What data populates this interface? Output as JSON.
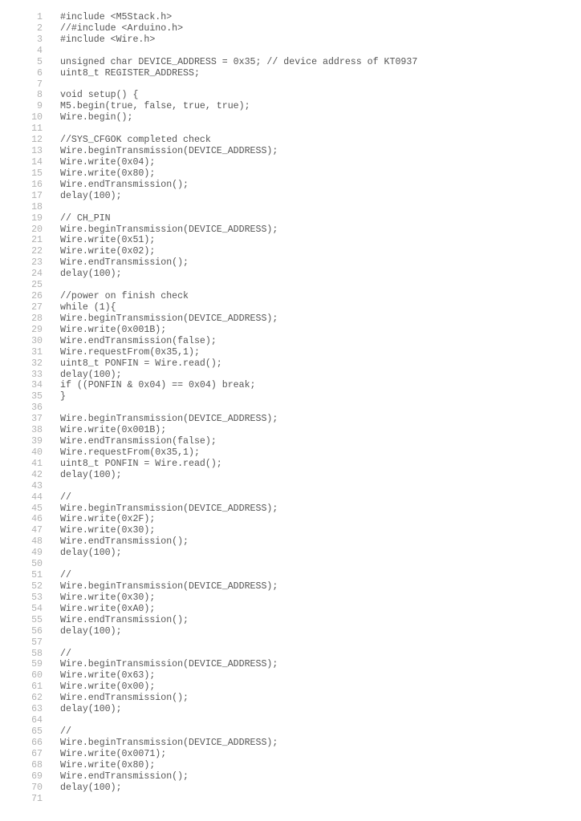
{
  "code": {
    "lines": [
      "#include <M5Stack.h>",
      "//#include <Arduino.h>",
      "#include <Wire.h>",
      "",
      "unsigned char DEVICE_ADDRESS = 0x35; // device address of KT0937",
      "uint8_t REGISTER_ADDRESS;",
      "",
      "void setup() {",
      "M5.begin(true, false, true, true);",
      "Wire.begin();",
      "",
      "//SYS_CFGOK completed check",
      "Wire.beginTransmission(DEVICE_ADDRESS);",
      "Wire.write(0x04);",
      "Wire.write(0x80);",
      "Wire.endTransmission();",
      "delay(100);",
      "",
      "// CH_PIN",
      "Wire.beginTransmission(DEVICE_ADDRESS);",
      "Wire.write(0x51);",
      "Wire.write(0x02);",
      "Wire.endTransmission();",
      "delay(100);",
      "",
      "//power on finish check",
      "while (1){",
      "Wire.beginTransmission(DEVICE_ADDRESS);",
      "Wire.write(0x001B);",
      "Wire.endTransmission(false);",
      "Wire.requestFrom(0x35,1);",
      "uint8_t PONFIN = Wire.read();",
      "delay(100);",
      "if ((PONFIN & 0x04) == 0x04) break;",
      "}",
      "",
      "Wire.beginTransmission(DEVICE_ADDRESS);",
      "Wire.write(0x001B);",
      "Wire.endTransmission(false);",
      "Wire.requestFrom(0x35,1);",
      "uint8_t PONFIN = Wire.read();",
      "delay(100);",
      "",
      "//",
      "Wire.beginTransmission(DEVICE_ADDRESS);",
      "Wire.write(0x2F);",
      "Wire.write(0x30);",
      "Wire.endTransmission();",
      "delay(100);",
      "",
      "//",
      "Wire.beginTransmission(DEVICE_ADDRESS);",
      "Wire.write(0x30);",
      "Wire.write(0xA0);",
      "Wire.endTransmission();",
      "delay(100);",
      "",
      "//",
      "Wire.beginTransmission(DEVICE_ADDRESS);",
      "Wire.write(0x63);",
      "Wire.write(0x00);",
      "Wire.endTransmission();",
      "delay(100);",
      "",
      "//",
      "Wire.beginTransmission(DEVICE_ADDRESS);",
      "Wire.write(0x0071);",
      "Wire.write(0x80);",
      "Wire.endTransmission();",
      "delay(100);",
      ""
    ]
  }
}
